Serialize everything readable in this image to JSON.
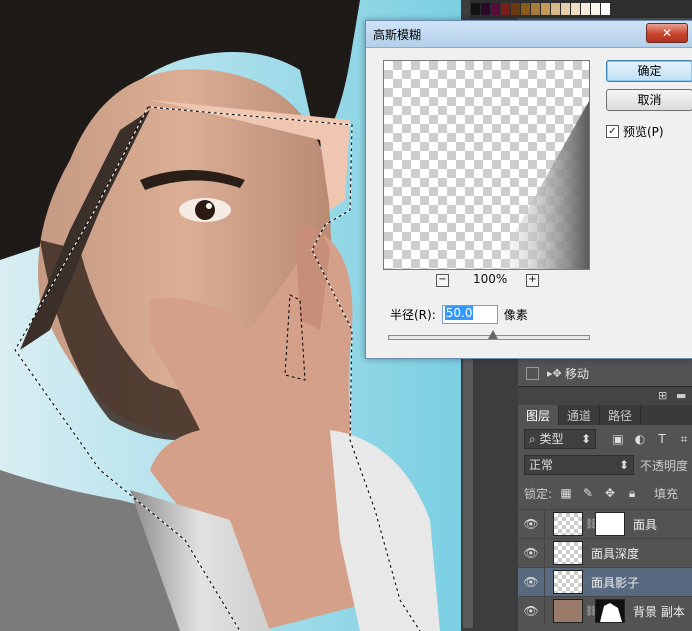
{
  "dialog": {
    "title": "高斯模糊",
    "close_glyph": "✕",
    "ok_label": "确定",
    "cancel_label": "取消",
    "preview_label": "预览(P)",
    "zoom_out_glyph": "−",
    "zoom_in_glyph": "+",
    "zoom_level": "100%",
    "radius_label": "半径(R):",
    "radius_value": "50.0",
    "radius_unit": "像素",
    "slider_fraction": 0.52
  },
  "history": {
    "item_label": "移动"
  },
  "layers_panel": {
    "tabs": [
      {
        "label": "图层"
      },
      {
        "label": "通道"
      },
      {
        "label": "路径"
      }
    ],
    "filter_label": "类型",
    "blend_mode": "正常",
    "opacity_label": "不透明度",
    "lock_label": "锁定:",
    "fill_label": "填充",
    "layers": [
      {
        "name": "面具"
      },
      {
        "name": "面具深度"
      },
      {
        "name": "面具影子"
      },
      {
        "name": "背景 副本"
      }
    ]
  },
  "colors": {
    "panel_bg": "#535353",
    "selected_layer": "#596a80",
    "dialog_bg": "#f0f0f0",
    "sky": "#8fd6e6"
  }
}
